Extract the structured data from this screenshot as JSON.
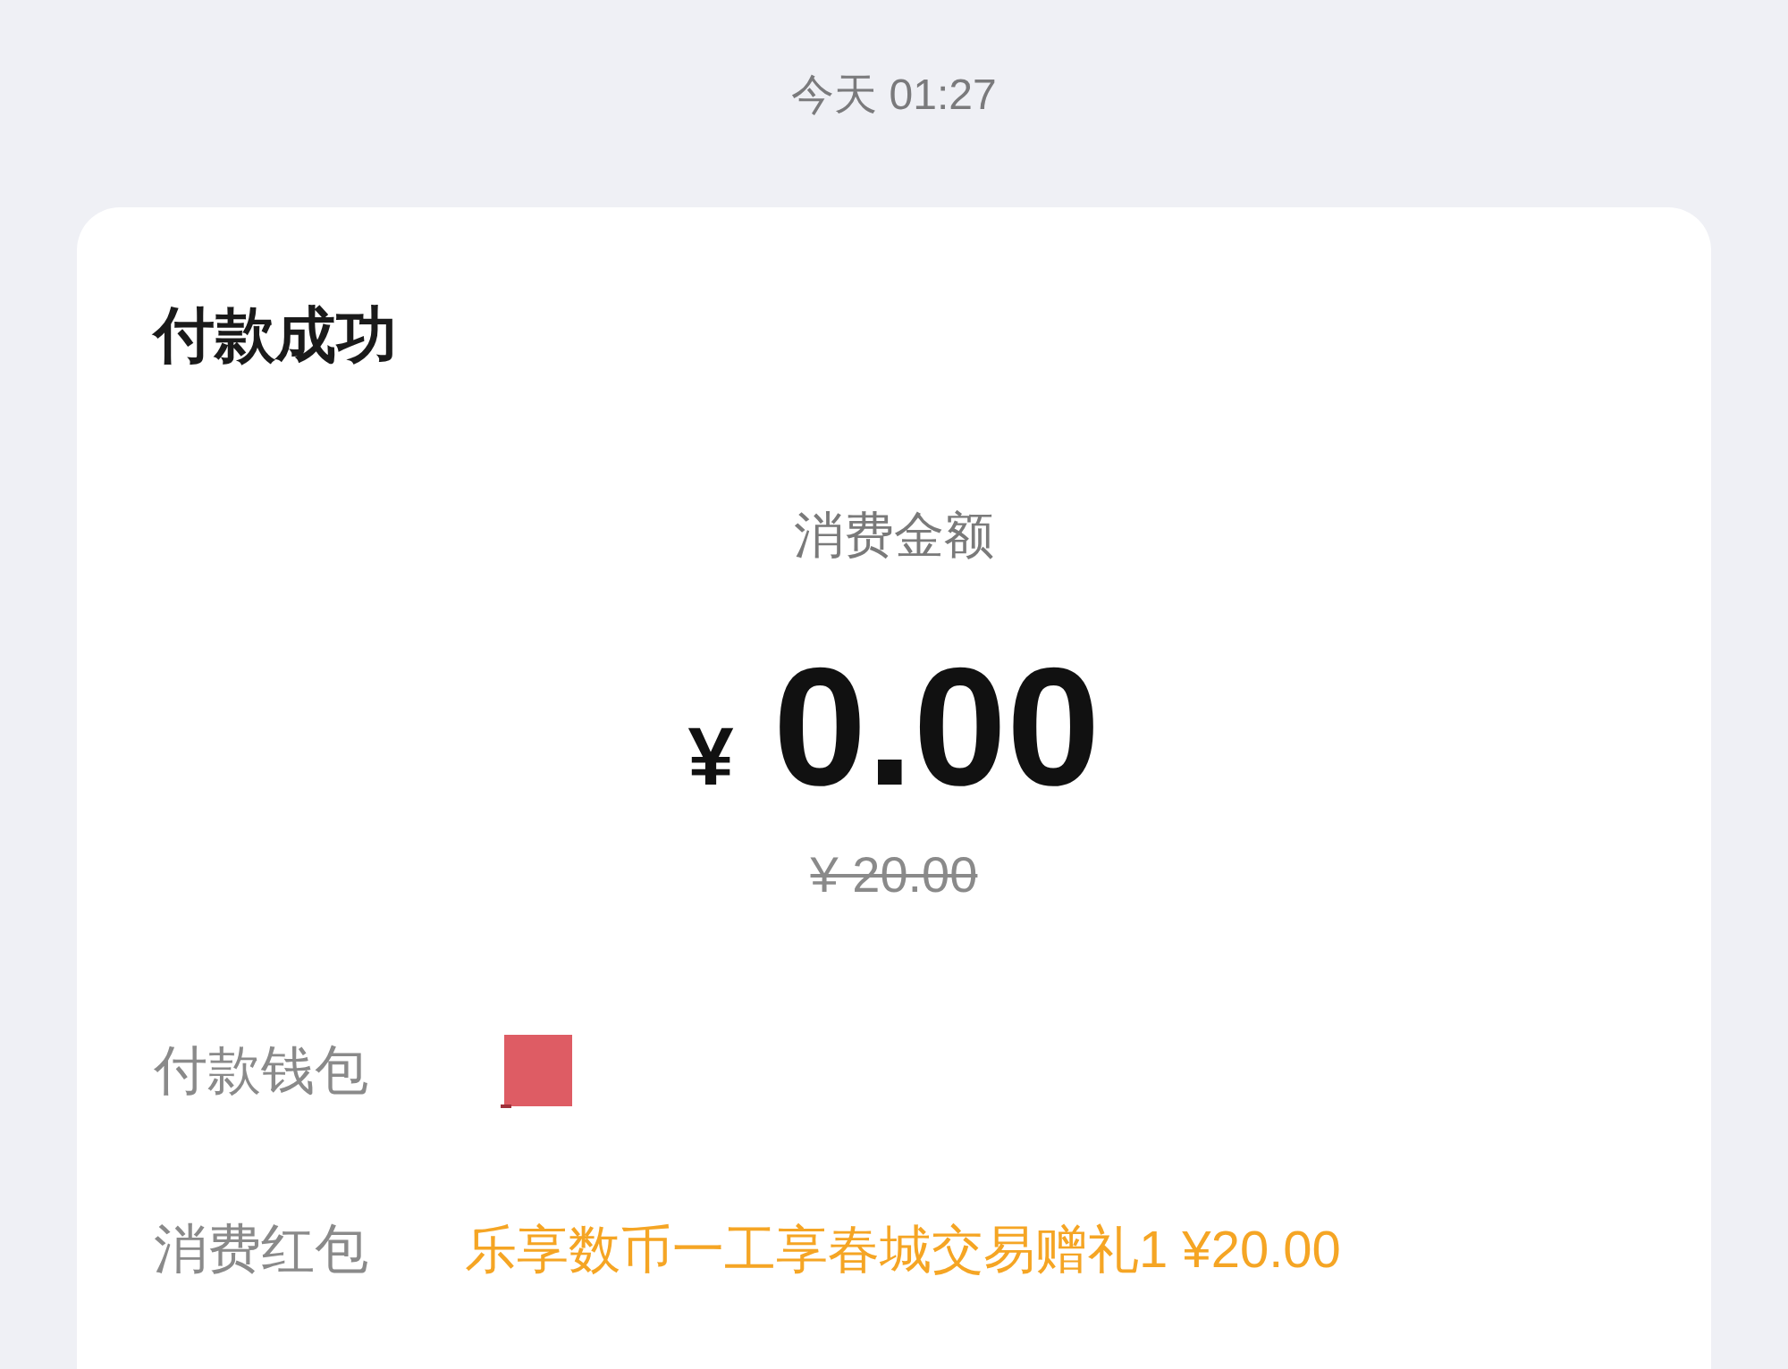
{
  "timestamp": "今天 01:27",
  "card": {
    "title": "付款成功",
    "amount_label": "消费金额",
    "currency": "¥",
    "amount": "0.00",
    "original_amount": "¥ 20.00",
    "rows": [
      {
        "label": "付款钱包",
        "kind": "redacted"
      },
      {
        "label": "消费红包",
        "kind": "text",
        "value": "乐享数币一工享春城交易赠礼1 ¥20.00"
      }
    ]
  }
}
